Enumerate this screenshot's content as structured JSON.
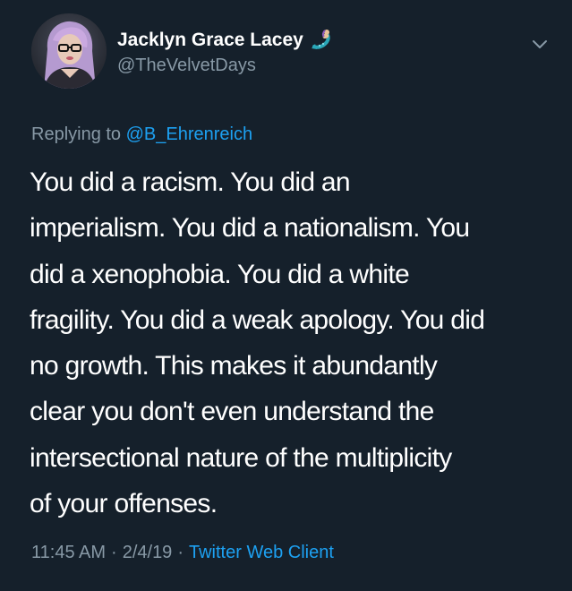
{
  "tweet": {
    "author": {
      "display_name": "Jacklyn Grace Lacey",
      "handle": "@TheVelvetDays",
      "name_emoji": "mermaid-icon"
    },
    "more_menu_icon": "chevron-down-icon",
    "replying_to": {
      "prefix": "Replying to",
      "mention": "@B_Ehrenreich"
    },
    "text_lines": [
      "You did a racism.  You did an",
      "imperialism.  You did a nationalism. You",
      "did a xenophobia. You did a white",
      "fragility. You did a weak apology. You did",
      "no growth. This makes it abundantly",
      "clear you don't even understand the",
      "intersectional nature of the multiplicity",
      "of your offenses."
    ],
    "meta": {
      "time": "11:45 AM",
      "separator": "·",
      "date": "2/4/19",
      "source": "Twitter Web Client"
    }
  },
  "colors": {
    "background": "#15202b",
    "primary_text": "#ffffff",
    "secondary_text": "#8899a6",
    "link": "#1da1f2"
  }
}
